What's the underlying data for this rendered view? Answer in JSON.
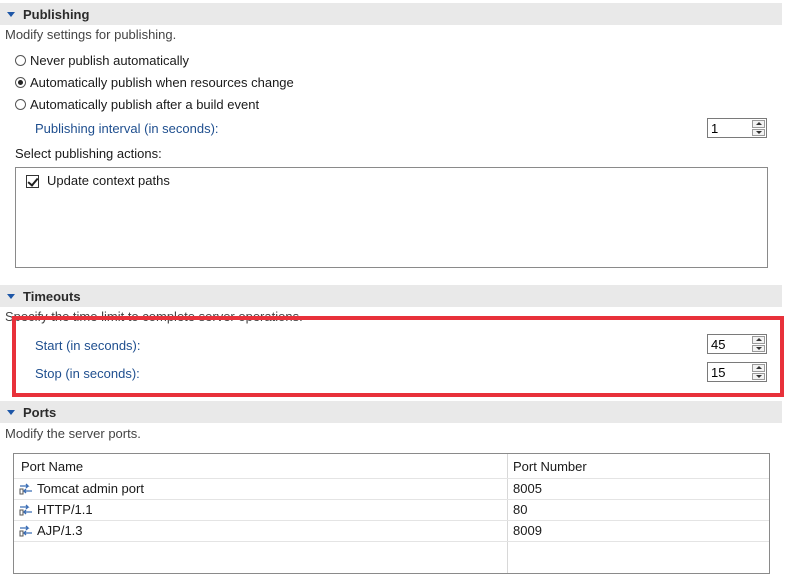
{
  "publishing": {
    "header": "Publishing",
    "description": "Modify settings for publishing.",
    "options": [
      {
        "label": "Never publish automatically",
        "checked": false
      },
      {
        "label": "Automatically publish when resources change",
        "checked": true
      },
      {
        "label": "Automatically publish after a build event",
        "checked": false
      }
    ],
    "interval_label": "Publishing interval (in seconds):",
    "interval_value": "1",
    "actions_label": "Select publishing actions:",
    "actions": [
      {
        "label": "Update context paths",
        "checked": true
      }
    ]
  },
  "timeouts": {
    "header": "Timeouts",
    "description": "Specify the time limit to complete server operations.",
    "start_label": "Start (in seconds):",
    "start_value": "45",
    "stop_label": "Stop (in seconds):",
    "stop_value": "15"
  },
  "ports": {
    "header": "Ports",
    "description": "Modify the server ports.",
    "columns": [
      "Port Name",
      "Port Number"
    ],
    "rows": [
      {
        "name": "Tomcat admin port",
        "number": "8005"
      },
      {
        "name": "HTTP/1.1",
        "number": "80"
      },
      {
        "name": "AJP/1.3",
        "number": "8009"
      }
    ]
  },
  "colors": {
    "label_blue": "#1f4f8f",
    "highlight": "#e8313a",
    "header_bg": "#e9e9e9"
  },
  "icons": {
    "section_toggle": "triangle-down-icon",
    "port": "port-link-icon"
  }
}
